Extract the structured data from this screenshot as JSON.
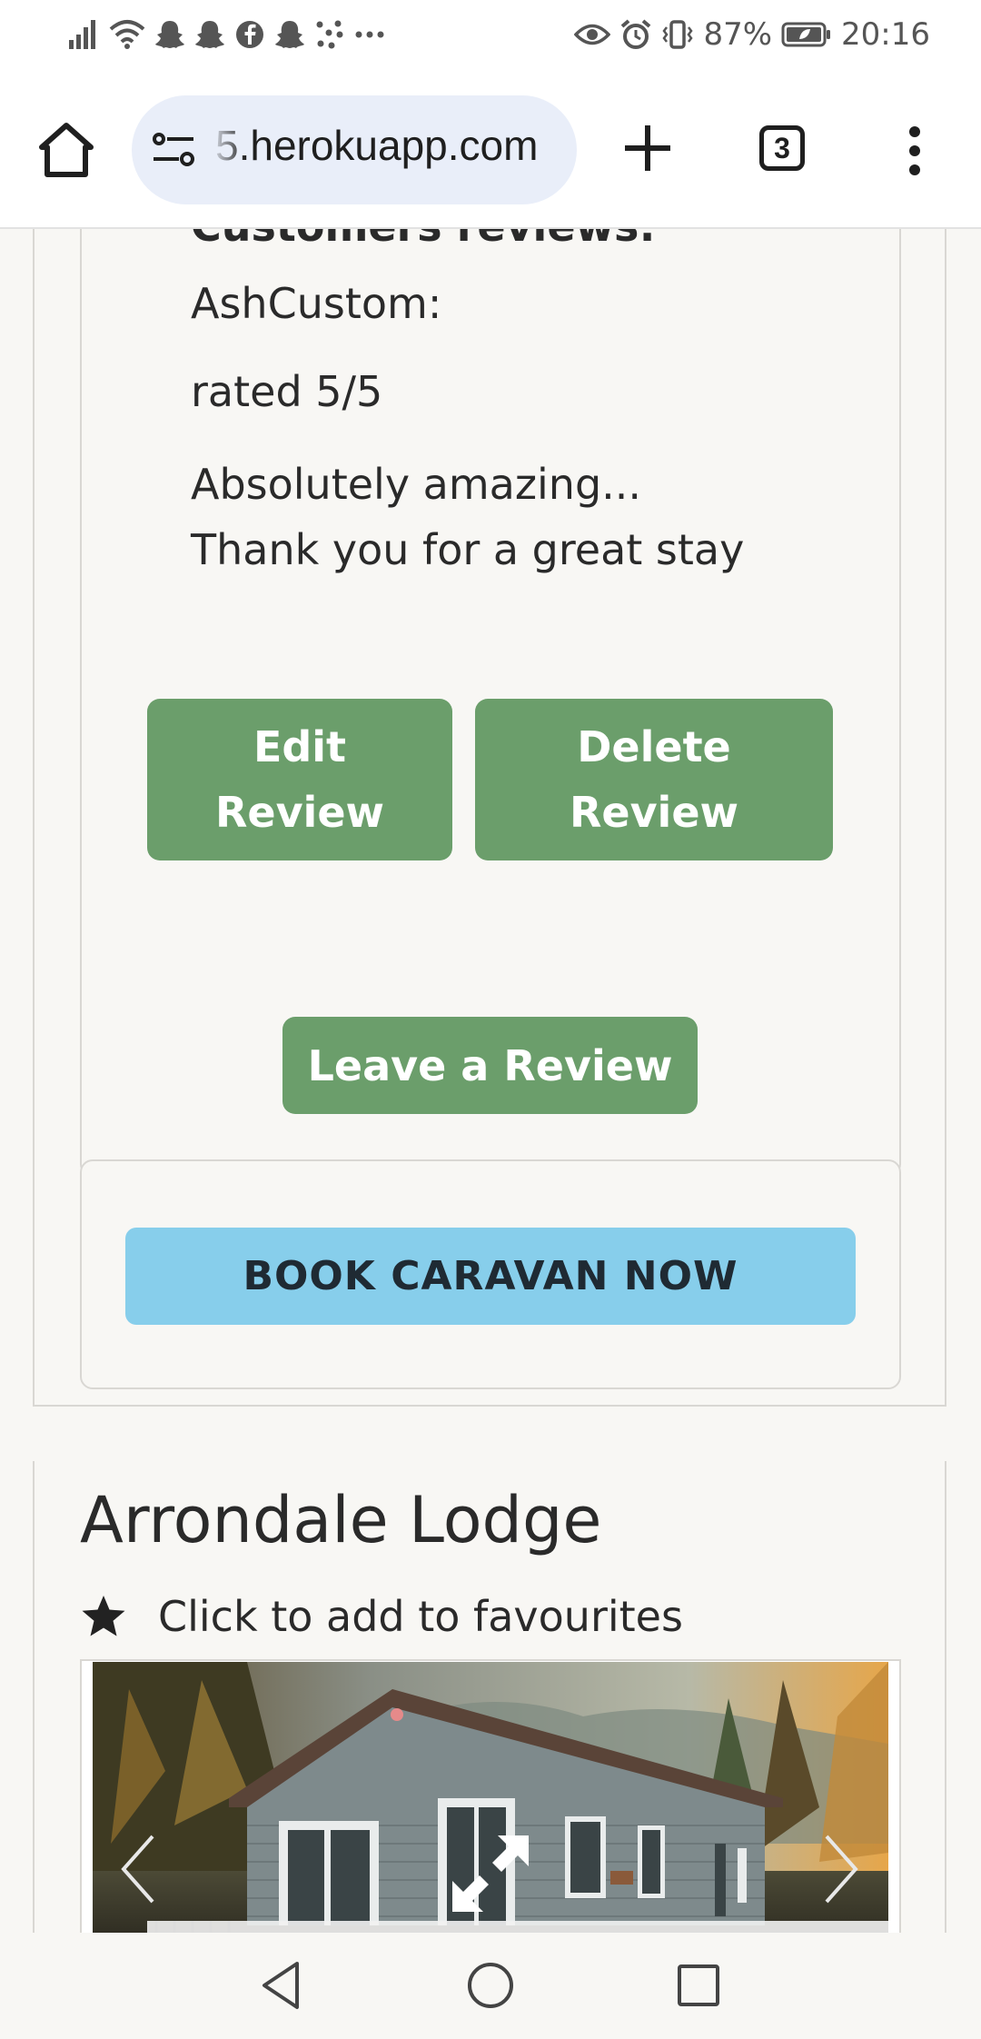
{
  "status_bar": {
    "battery": "87%",
    "time": "20:16",
    "left_icons": [
      "signal-icon",
      "wifi-icon",
      "snapchat-icon",
      "snapchat-icon",
      "facebook-icon",
      "snapchat-icon",
      "dots-app-icon",
      "more-notifications-icon"
    ],
    "right_icons": [
      "eye-icon",
      "alarm-icon",
      "vibrate-icon",
      "battery-icon"
    ]
  },
  "browser": {
    "url": "5.herokuapp.com",
    "tab_count": "3"
  },
  "reviews": {
    "heading": "Customers reviews:",
    "author": "AshCustom:",
    "rating": "rated 5/5",
    "text_line1": "Absolutely amazing...",
    "text_line2": "Thank you for a great stay",
    "edit_label_1": "Edit",
    "edit_label_2": "Review",
    "delete_label_1": "Delete",
    "delete_label_2": "Review"
  },
  "leave_review_label": "Leave a Review",
  "book_label": "BOOK CARAVAN NOW",
  "lodge": {
    "title": "Arrondale Lodge",
    "favourite_text": "Click to add to favourites"
  },
  "colors": {
    "green_button": "#6b9e6b",
    "book_button": "#87ceeb",
    "page_bg": "#f8f7f4",
    "url_pill": "#e9eef9"
  }
}
